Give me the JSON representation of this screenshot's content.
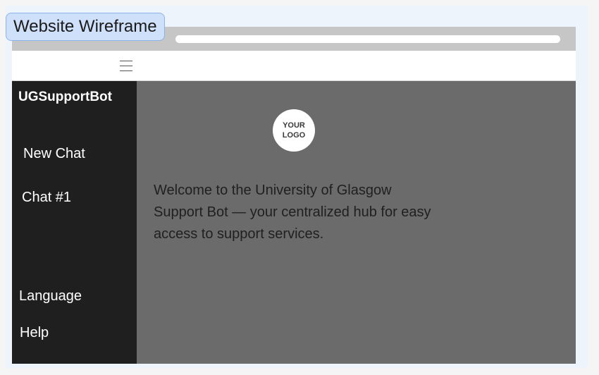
{
  "frame": {
    "label": "Website Wireframe"
  },
  "header": {
    "menu_icon": "hamburger-menu-icon"
  },
  "sidebar": {
    "brand": "UGSupportBot",
    "items": [
      {
        "label": "New Chat"
      },
      {
        "label": "Chat #1"
      },
      {
        "label": "Language"
      },
      {
        "label": "Help"
      }
    ]
  },
  "main": {
    "logo_text": "YOUR\nLOGO",
    "welcome": "Welcome to the University of Glasgow Support Bot — your centralized hub for easy access to support services."
  },
  "colors": {
    "canvas_bg": "#eef4fb",
    "frame_label_bg": "#cfe0fb",
    "frame_label_border": "#8bb3ea",
    "browser_bar": "#c6c6c6",
    "sidebar_bg": "#1f1f1f",
    "main_bg": "#6b6b6b",
    "logo_bg": "#ffffff"
  }
}
